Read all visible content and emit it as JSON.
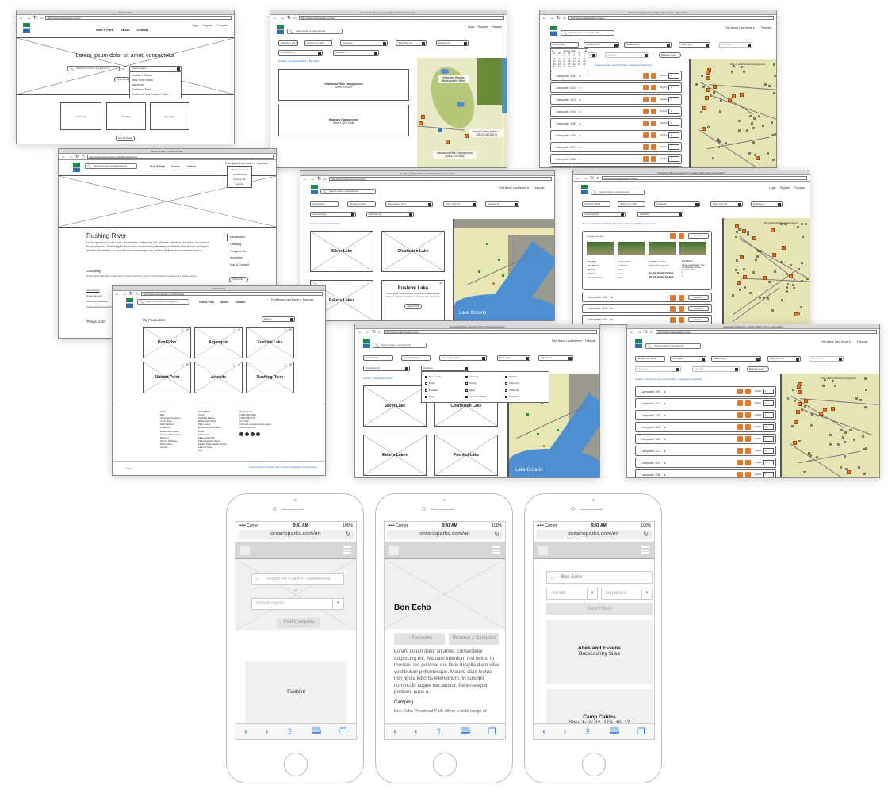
{
  "windows": {
    "home": {
      "title": "Ontario Parks",
      "url": "http://www.ontarioparks.com/en",
      "nav": [
        "Visit A Park",
        "About",
        "Contact"
      ],
      "toplinks": [
        "Login",
        "Register",
        "Français"
      ],
      "hero": "Lorem ipsum dolor sit amet, consectetur",
      "search_placeholder": "Search for park or campground",
      "or": "or",
      "region_select": "Select Region",
      "region_options": [
        "Northern Ontario",
        "Near North Parks",
        "Algonquin",
        "Southeast Parks",
        "Southwest and Central Parks"
      ],
      "find_button": "Find Campsite",
      "tiles": [
        "Landscape",
        "Rotating",
        "Algonquin"
      ],
      "see_all": "See All Parks"
    },
    "parkdetail": {
      "title": "Rushing River | Ontario Parks",
      "url": "http://www.ontarioparks.com/park/rushingriver",
      "search_placeholder": "Search for park or campground",
      "nav": [
        "Visit A Park",
        "About",
        "Contact"
      ],
      "user_menu": "First Name Last Name ▾",
      "lang": "Français",
      "user_dropdown": [
        "My Reservations",
        "My Favourites",
        "Account Info",
        "Log Out"
      ],
      "park_name": "Rushing River",
      "intro": "Lorem ipsum dolor sit amet, consectetur adipiscing elit. Aliquam interdum nisl tellus, in rhoncus leo pulvinar eu. Duis fringilla diam vitae vestibulum pellentesque. Mauris vitae lectus non ligula lobortis elementum. In suscipit commodo augue nec auctor. Pellentesque pretium, nunc a.",
      "camping_heading": "Camping",
      "camping_text": "Rushing River Park offers a wide range of camping options for visitors, from car camping to backcountry sites and cabins.",
      "camping_links": [
        "Car Camping",
        "Group Camping",
        "Radio-free Campsites",
        "Trailer Equipped Campsites"
      ],
      "things_heading": "Things to Do",
      "side_nav": [
        "Introduction",
        "Camping",
        "Things to Do",
        "Amenities",
        "Map & Contact"
      ],
      "favourite_button": "♥ Favourite"
    },
    "favourites": {
      "title": "Ontario Parks",
      "url": "http://www.ontarioparks.com/favourites",
      "search_placeholder": "Search for park or campground",
      "nav": [
        "Visit A Park",
        "About",
        "Contact"
      ],
      "user_menu": "First Name Last Name ▾",
      "lang": "Français",
      "heading": "My Favourites",
      "sort": "Sort by",
      "parks": [
        "Bon Echo",
        "Algonquin",
        "Fushimi Lake",
        "Sibbald Point",
        "Awenda",
        "Rushing River"
      ],
      "footer": {
        "col1_title": "About",
        "col1": [
          "Blog",
          "Green Energy Report",
          "In Your Park",
          "Park Statistics",
          "Legislation",
          "Employment Inquiry",
          "Careers & Internships",
          "Planning",
          "Friends of Ontario",
          "Partnerships",
          "Careers"
        ],
        "col2_title": "Visit A Park",
        "col2": [
          "Prices",
          "Seasonal Passes",
          "Reservation Policy",
          "Park Locator",
          "Roofed Accommodation",
          "Winter",
          "Park Events",
          "Parks Guide PDF",
          "Park Newsletter Signup",
          "Healthy Parks Healthy People",
          "Learn to Camp",
          "FAQ"
        ],
        "col3_title": "Get In Touch",
        "col3": [
          "1-888-ONT-PARK",
          "1-888-668-7275",
          "Live Chat",
          "Chat with a Contact Centre agent",
          "Connect With Us"
        ],
        "legal": "© Queen's Printer for Ontario, 2018 · Privacy | Accessibility | Important Notices",
        "brand": "Ontario"
      }
    },
    "southeast": {
      "title": "Southeast Parks | Ontario Parks Online Reservation",
      "url": "http://www.ontarioparks.com/res",
      "search_placeholder": "Search park or campground",
      "toplinks": [
        "Login",
        "Register",
        "Français"
      ],
      "filters": [
        "August 9, 2017",
        "August 13, 2017",
        "Campsite",
        "Party Size (4)",
        "Equipment",
        "Amenities (3)",
        "Activities"
      ],
      "crumbs": [
        "Ontario",
        "Southeast Parks",
        "Bon Echo"
      ],
      "list": [
        {
          "name": "Hardwood Hills Campground",
          "sub": "Sites 400-500"
        },
        {
          "name": "Mazinaw Campground",
          "sub": "Sites 1-400 Trails"
        }
      ],
      "map_labels": [
        "Abes and Essens (Backcountry Sites)",
        "Camp Cabins (Sites 1-10/12/12A/16/17)",
        "Hardwood Hills Campground (Sites 400-500)"
      ]
    },
    "calendar": {
      "title": "Sasquatch Highlands | Ontario Parks Online Reservation",
      "url": "http://www.ontarioparks.com/res",
      "search_placeholder": "Search park or campground",
      "user_menu": "First Name Last Name ▾",
      "lang": "Français",
      "filters": [
        "Arrival Date",
        "Access Point",
        "Backcountry",
        "Party Size",
        "Equipment",
        "Amenities",
        "Activities"
      ],
      "reserve_now": "Reserve Now",
      "calendar_month": "January 2019",
      "calendar_days": [
        "S",
        "M",
        "T",
        "W",
        "T",
        "F",
        "S"
      ],
      "calendar_dates": [
        1,
        2,
        3,
        4,
        5,
        6,
        7,
        8,
        9,
        10,
        11,
        12,
        13,
        14,
        15,
        16,
        17,
        18,
        19,
        20,
        21,
        22,
        23,
        24,
        25,
        26,
        27,
        28,
        29,
        30,
        31
      ],
      "crumbs": [
        "Ontario",
        "Southwest and Central Parks",
        "Sasquatch Highlands"
      ],
      "campsites": [
        "Campsite 101",
        "Campsite 102",
        "Campsite 103",
        "Campsite 104",
        "Campsite 105",
        "Campsite 106",
        "Campsite 107",
        "Campsite 108",
        "Campsite 109"
      ],
      "nights_label": "Nights",
      "nights_value": "1",
      "map_label": "Hwy 41 and Mazinaw Campground"
    },
    "regionmap": {
      "title": "Southeast Parks | Ontario Parks Online Reservation",
      "url": "http://www.ontarioparks.com/res",
      "search_placeholder": "Search park or campground",
      "user_menu": "First Name Last Name ▾",
      "lang": "Français",
      "filters": [
        "Arrival Date",
        "Departure Date",
        "Reservation Type",
        "Party Size (4)",
        "Equipment",
        "Amenities (4)",
        "Activities (1)"
      ],
      "crumbs": [
        "Ontario",
        "Southeast Ontario"
      ],
      "parks": [
        "Silver Lake",
        "Charleston Lake",
        "Eskers Lakes",
        "Fushimi Lake"
      ],
      "popup": {
        "title": "Fushimi Lake",
        "text": "Lorem ipsum dolor sit amet, consectetur adipiscing elit. Aliquam interdum nisl tellus, in rhoncus leo pulvinar eu.",
        "button": "Read More"
      },
      "lake": "Lake Ontario"
    },
    "campsite": {
      "title": "Hardwood Hills Campground | Ontario Parks Online Reservation",
      "url": "http://www.ontarioparks.com/res",
      "search_placeholder": "Search park or campground",
      "toplinks": [
        "Login",
        "Register",
        "Français"
      ],
      "filters": [
        "August 9, 2017",
        "August 13, 2017",
        "Campsite",
        "Party Size (4)",
        "Equipment",
        "Amenities (3)",
        "Activities"
      ],
      "crumbs": [
        "Ontario",
        "Southeast Parks",
        "Bon Echo",
        "Hardwood Hills Campground"
      ],
      "expanded": {
        "name": "Campsite 403",
        "details": [
          [
            "Pet Type",
            "Regular Pets"
          ],
          [
            "Site Shade",
            "Full Shade"
          ],
          [
            "Quality",
            "Good"
          ],
          [
            "Privacy",
            "Good"
          ],
          [
            "Ground Cover",
            "Soil"
          ]
        ],
        "details2": [
          [
            "Fire Pit Location",
            "Back Right"
          ],
          [
            "Allowed Equipment",
            "Single tent/shelter, Two tents/shelter, Three tents/shelters"
          ],
          [
            "On-Site Vehicle Parking",
            "2"
          ],
          [
            "Off-Site Vehicle Parking",
            "2"
          ]
        ]
      },
      "others": [
        "Campsite 402",
        "Campsite 403",
        "Campsite 404"
      ],
      "reserve": "Reserve",
      "map_label": "Hwy 41 and Mazinaw Campground"
    },
    "activities": {
      "title": "Southeast Parks | Ontario Parks Online Reservation",
      "url": "http://www.ontarioparks.com/en",
      "search_placeholder": "Search park or campground",
      "user_menu": "First Name Last Name ▾",
      "lang": "Français",
      "filters": [
        "Arrival Date",
        "Departure Date",
        "Reservation Type",
        "Party Size",
        "Equipment",
        "Amenities (3)",
        "Activities"
      ],
      "crumbs": [
        "Ontario",
        "Southeast Ontario"
      ],
      "activity_options": [
        "Boat Launch",
        "Beach",
        "Baseball",
        "Biking",
        "Canoeing",
        "Fishing",
        "Hiking",
        "Horseback Riding",
        "Portage",
        "Swimming",
        "Volleyball",
        "Basketball"
      ],
      "parks": [
        "Silver Lake",
        "Charleston Lake",
        "Eskers Lakes",
        "Fushimi Lake"
      ],
      "lake": "Lake Ontario"
    },
    "campsites2": {
      "title": "Sasquatch Highlands | Ontario Parks Online Reservation",
      "url": "http://www.ontarioparks.com/en",
      "search_placeholder": "Search park or campground",
      "user_menu": "First Name Last Name ▾",
      "lang": "Français",
      "filters": [
        "January 31, 2019",
        "Cold Lake",
        "Backcountry",
        "Party Size (4)",
        "Equipment",
        "Amenities",
        "Activities"
      ],
      "reserve_now": "Reserve Now",
      "crumbs": [
        "Ontario",
        "Southwest and Central Parks",
        "Sasquatch Highlands"
      ],
      "campsites": [
        "Campsite 106",
        "Campsite 107",
        "Campsite 109",
        "Campsite 101",
        "Campsite 102",
        "Campsite 103",
        "Campsite 104",
        "Campsite 108"
      ],
      "nights_label": "Nights",
      "nights_values": [
        "1",
        "1",
        "1",
        "4",
        "1",
        "1",
        "1",
        "1"
      ],
      "map_label": "Hwy 41 and Mazinaw Campground"
    }
  },
  "phones": [
    {
      "carrier": "••••• Carrier",
      "time": "9:41 AM",
      "battery": "100%",
      "url": "ontarioparks.com/en",
      "search_placeholder": "Search for a park or campground",
      "or": "or",
      "region_placeholder": "Select region",
      "find_button": "Find Campsite",
      "card": "Fushimi"
    },
    {
      "carrier": "••••• Carrier",
      "time": "9:41 AM",
      "battery": "100%",
      "url": "ontarioparks.com/en",
      "park_name": "Bon Echo",
      "favourite": "Favourite",
      "reserve": "Reserve a Campsite",
      "body": "Lorem ipsum dolor sit amet, consectetur adipiscing elit. Aliquam interdum nisl tellus, in rhoncus leo pulvinar eu. Duis fringilla diam vitae vestibulum pellentesque. Mauris vitae lectus non ligula lobortis elementum. In suscipit commodo augue nec auctor. Pellentesque pretium, nunc a.",
      "section": "Camping",
      "section_text": "Bon Echo Provincial Park offers a wide range of"
    },
    {
      "carrier": "••••• Carrier",
      "time": "9:41 AM",
      "battery": "100%",
      "url": "ontarioparks.com/en",
      "search_value": "Bon Echo",
      "arrival": "Arrival",
      "departure": "Departure",
      "more_filters": "More Filters",
      "cards": [
        {
          "title": "Abes and Essens",
          "sub": "Backcountry Sites"
        },
        {
          "title": "Camp Cabins",
          "sub": "Sites 1-10, 12, 12A, 16, 17"
        }
      ]
    }
  ],
  "toolbar_icons": [
    "back-icon",
    "forward-icon",
    "share-icon",
    "bookmarks-icon",
    "tabs-icon"
  ],
  "colors": {
    "accent_orange": "#e07a2d",
    "link_blue": "#2a6fc4",
    "map_green": "#e4e4b5",
    "lake_blue": "#4e8fd1"
  }
}
